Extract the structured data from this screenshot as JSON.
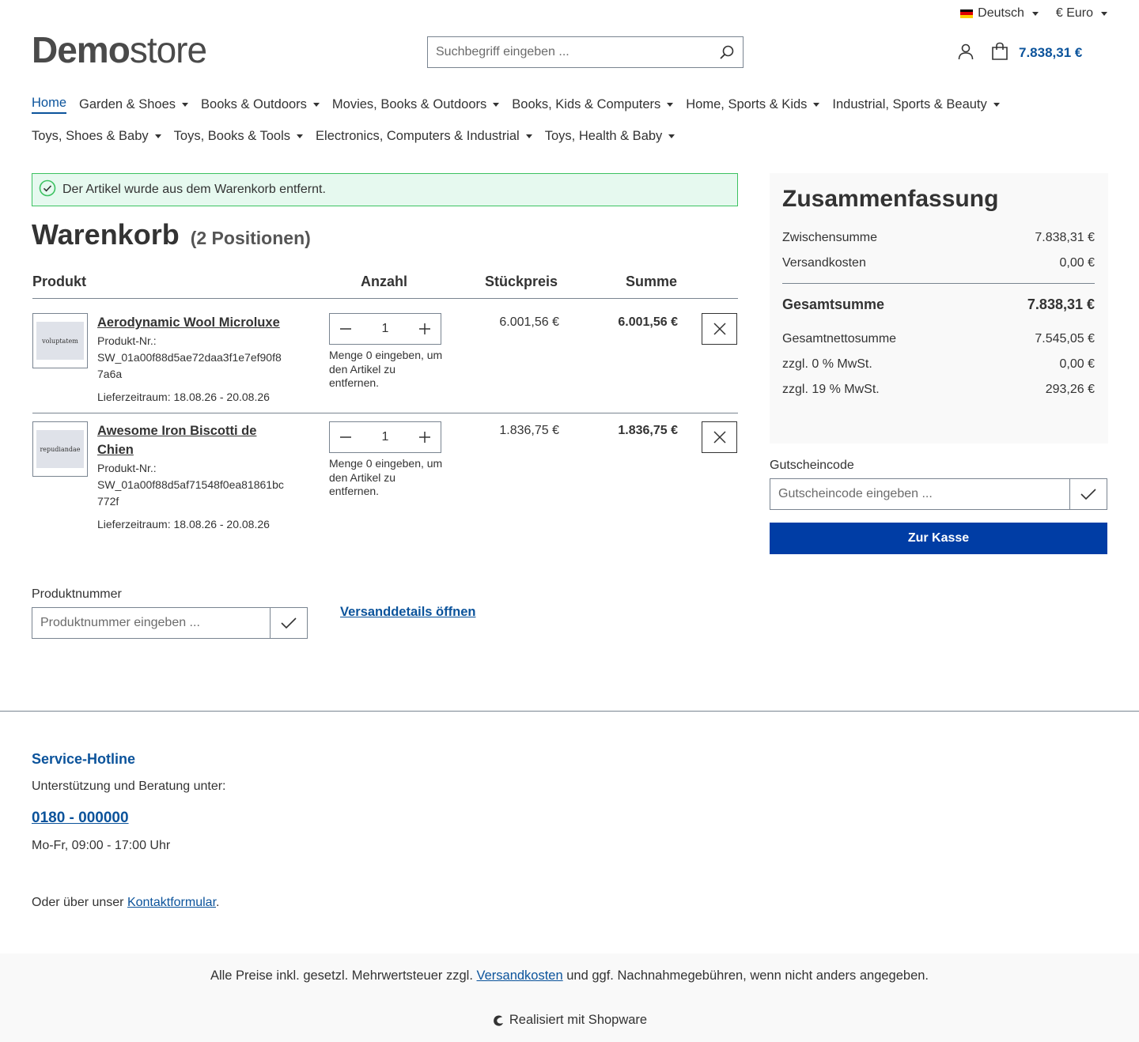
{
  "topbar": {
    "language": "Deutsch",
    "currency": "€ Euro"
  },
  "header": {
    "logo_bold": "Demo",
    "logo_light": "store",
    "search_placeholder": "Suchbegriff eingeben ...",
    "cart_total": "7.838,31 €"
  },
  "nav": {
    "home": "Home",
    "items": [
      "Garden & Shoes",
      "Books & Outdoors",
      "Movies, Books & Outdoors",
      "Books, Kids & Computers",
      "Home, Sports & Kids",
      "Industrial, Sports & Beauty",
      "Toys, Shoes & Baby",
      "Toys, Books & Tools",
      "Electronics, Computers & Industrial",
      "Toys, Health & Baby"
    ]
  },
  "alert": {
    "text": "Der Artikel wurde aus dem Warenkorb entfernt.",
    "color": "#3cc261"
  },
  "cart": {
    "title": "Warenkorb",
    "count": "(2 Positionen)",
    "col_product": "Produkt",
    "col_qty": "Anzahl",
    "col_unit": "Stückpreis",
    "col_sum": "Summe",
    "items": [
      {
        "image_text": "voluptatem",
        "name": "Aerodynamic Wool Microluxe",
        "sku_label": "Produkt-Nr.:",
        "sku": "SW_01a00f88d5ae72daa3f1e7ef90f87a6a",
        "delivery": "Lieferzeitraum: 18.08.26 - 20.08.26",
        "qty": "1",
        "qty_hint": "Menge 0 eingeben, um den Artikel zu entfernen.",
        "unit_price": "6.001,56 €",
        "total": "6.001,56 €"
      },
      {
        "image_text": "repudiandae",
        "name": "Awesome Iron Biscotti de Chien",
        "sku_label": "Produkt-Nr.:",
        "sku": "SW_01a00f88d5af71548f0ea81861bc772f",
        "delivery": "Lieferzeitraum: 18.08.26 - 20.08.26",
        "qty": "1",
        "qty_hint": "Menge 0 eingeben, um den Artikel zu entfernen.",
        "unit_price": "1.836,75 €",
        "total": "1.836,75 €"
      }
    ]
  },
  "product_number": {
    "label": "Produktnummer",
    "placeholder": "Produktnummer eingeben ..."
  },
  "shipping_link": "Versanddetails öffnen",
  "summary": {
    "title": "Zusammenfassung",
    "subtotal_label": "Zwischensumme",
    "subtotal": "7.838,31 €",
    "shipping_label": "Versandkosten",
    "shipping": "0,00 €",
    "total_label": "Gesamtsumme",
    "total": "7.838,31 €",
    "net_label": "Gesamtnettosumme",
    "net": "7.545,05 €",
    "tax0_label": "zzgl. 0 % MwSt.",
    "tax0": "0,00 €",
    "tax19_label": "zzgl. 19 % MwSt.",
    "tax19": "293,26 €"
  },
  "voucher": {
    "label": "Gutscheincode",
    "placeholder": "Gutscheincode eingeben ..."
  },
  "checkout_label": "Zur Kasse",
  "footer": {
    "hotline_title": "Service-Hotline",
    "hotline_text": "Unterstützung und Beratung unter:",
    "phone": "0180 - 000000",
    "hours": "Mo-Fr, 09:00 - 17:00 Uhr",
    "contact_prefix": "Oder über unser ",
    "contact_link": "Kontaktformular",
    "contact_suffix": ".",
    "vat_prefix": "Alle Preise inkl. gesetzl. Mehrwertsteuer zzgl. ",
    "vat_link": "Versandkosten",
    "vat_suffix": " und ggf. Nachnahmegebühren, wenn nicht anders angegeben.",
    "made_with": "Realisiert mit Shopware"
  },
  "colors": {
    "primary": "#0b539b",
    "button": "#003da5",
    "success": "#3cc261"
  }
}
